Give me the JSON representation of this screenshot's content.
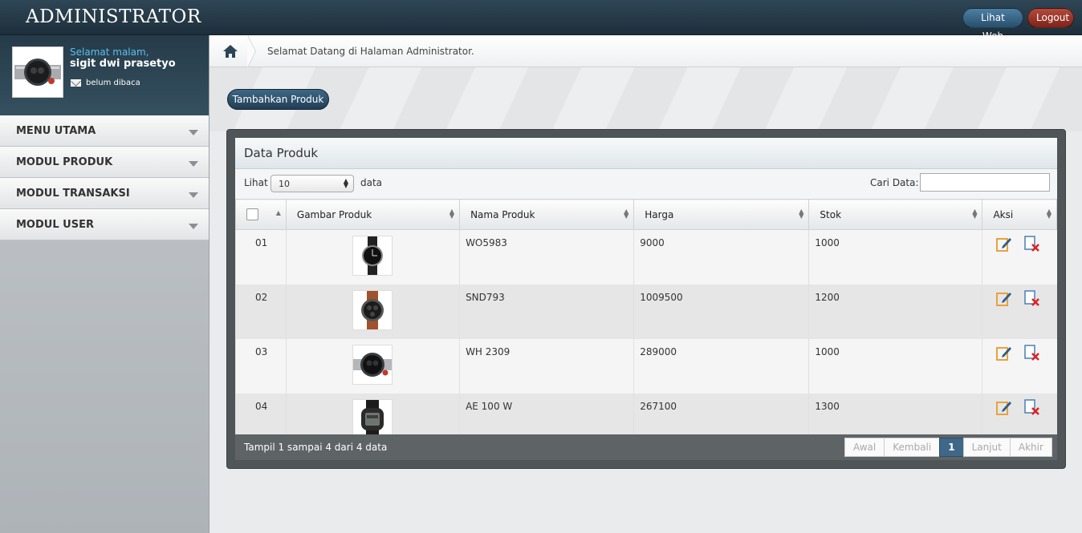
{
  "app": {
    "title": "ADMINISTRATOR",
    "lihat_web": "Lihat Web",
    "logout": "Logout"
  },
  "profile": {
    "greeting": "Selamat malam,",
    "name": "sigit dwi prasetyo",
    "messages": "belum dibaca"
  },
  "sidebar": {
    "items": [
      {
        "label": "MENU UTAMA"
      },
      {
        "label": "MODUL PRODUK"
      },
      {
        "label": "MODUL TRANSAKSI"
      },
      {
        "label": "MODUL USER"
      }
    ]
  },
  "breadcrumb": {
    "text": "Selamat Datang di Halaman Administrator."
  },
  "actions": {
    "add_product": "Tambahkan Produk"
  },
  "panel": {
    "title": "Data Produk",
    "show_label": "Lihat",
    "page_size": "10",
    "data_label": "data",
    "search_label": "Cari Data:",
    "search_value": "",
    "columns": [
      "Gambar Produk",
      "Nama Produk",
      "Harga",
      "Stok",
      "Aksi"
    ],
    "rows": [
      {
        "no": "01",
        "name": "WO5983",
        "price": "9000",
        "stock": "1000"
      },
      {
        "no": "02",
        "name": "SND793",
        "price": "1009500",
        "stock": "1200"
      },
      {
        "no": "03",
        "name": "WH 2309",
        "price": "289000",
        "stock": "1000"
      },
      {
        "no": "04",
        "name": "AE 100 W",
        "price": "267100",
        "stock": "1300"
      }
    ],
    "footer_info": "Tampil 1 sampai 4 dari 4 data",
    "pager": {
      "first": "Awal",
      "prev": "Kembali",
      "current": "1",
      "next": "Lanjut",
      "last": "Akhir"
    }
  },
  "colors": {
    "topbar": "#1d2f3b",
    "accent": "#3f6788",
    "logout": "#7f2318",
    "greeting": "#5bc0f0"
  },
  "icons": [
    "home-icon",
    "mail-icon",
    "edit-icon",
    "delete-icon",
    "watch-thumbnail"
  ]
}
